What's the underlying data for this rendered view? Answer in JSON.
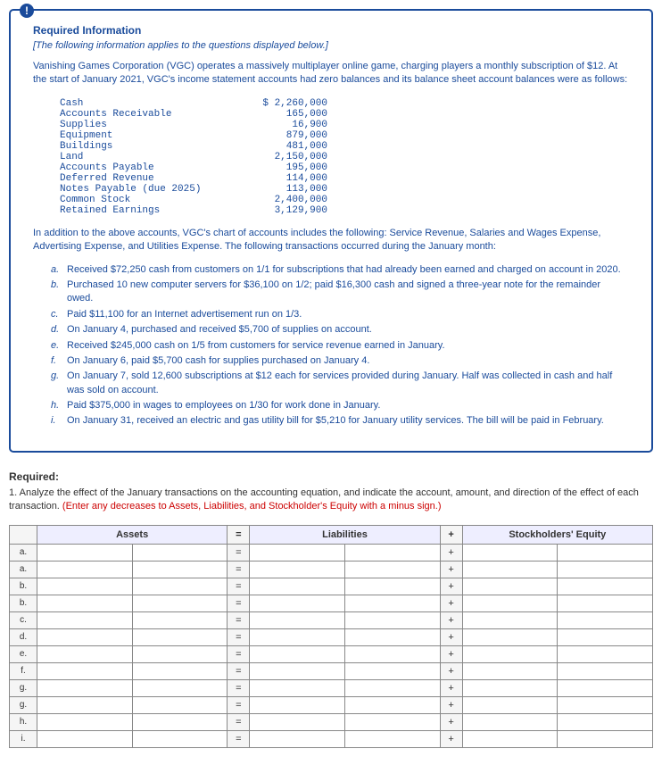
{
  "header": {
    "required": "Required Information",
    "note": "[The following information applies to the questions displayed below.]"
  },
  "intro": "Vanishing Games Corporation (VGC) operates a massively multiplayer online game, charging players a monthly subscription of $12. At the start of January 2021, VGC's income statement accounts had zero balances and its balance sheet account balances were as follows:",
  "accounts": [
    {
      "label": "Cash",
      "value": "$ 2,260,000"
    },
    {
      "label": "Accounts Receivable",
      "value": "165,000"
    },
    {
      "label": "Supplies",
      "value": "16,900"
    },
    {
      "label": "Equipment",
      "value": "879,000"
    },
    {
      "label": "Buildings",
      "value": "481,000"
    },
    {
      "label": "Land",
      "value": "2,150,000"
    },
    {
      "label": "Accounts Payable",
      "value": "195,000"
    },
    {
      "label": "Deferred Revenue",
      "value": "114,000"
    },
    {
      "label": "Notes Payable (due 2025)",
      "value": "113,000"
    },
    {
      "label": "Common Stock",
      "value": "2,400,000"
    },
    {
      "label": "Retained Earnings",
      "value": "3,129,900"
    }
  ],
  "middle": "In addition to the above accounts, VGC's chart of accounts includes the following: Service Revenue, Salaries and Wages Expense, Advertising Expense, and Utilities Expense. The following transactions occurred during the January month:",
  "transactions": [
    {
      "l": "a.",
      "t": "Received $72,250 cash from customers on 1/1 for subscriptions that had already been earned and charged on account in 2020."
    },
    {
      "l": "b.",
      "t": "Purchased 10 new computer servers for $36,100 on 1/2; paid $16,300 cash and signed a three-year note for the remainder owed."
    },
    {
      "l": "c.",
      "t": "Paid $11,100 for an Internet advertisement run on 1/3."
    },
    {
      "l": "d.",
      "t": "On January 4, purchased and received $5,700 of supplies on account."
    },
    {
      "l": "e.",
      "t": "Received $245,000 cash on 1/5 from customers for service revenue earned in January."
    },
    {
      "l": "f.",
      "t": "On January 6, paid $5,700 cash for supplies purchased on January 4."
    },
    {
      "l": "g.",
      "t": "On January 7, sold 12,600 subscriptions at $12 each for services provided during January. Half was collected in cash and half was sold on account."
    },
    {
      "l": "h.",
      "t": "Paid $375,000 in wages to employees on 1/30 for work done in January."
    },
    {
      "l": "i.",
      "t": "On January 31, received an electric and gas utility bill for $5,210 for January utility services. The bill will be paid in February."
    }
  ],
  "required_section": {
    "label": "Required:",
    "q1a": "1. Analyze the effect of the January transactions on the accounting equation, and indicate the account, amount, and direction of the effect of each transaction. ",
    "q1b": "(Enter any decreases to Assets, Liabilities, and Stockholder's Equity with a minus sign.)"
  },
  "grid": {
    "cols": [
      "Assets",
      "Liabilities",
      "Stockholders' Equity"
    ],
    "rows": [
      "a.",
      "a.",
      "b.",
      "b.",
      "c.",
      "d.",
      "e.",
      "f.",
      "g.",
      "g.",
      "h.",
      "i."
    ],
    "eq": "=",
    "plus": "+"
  }
}
